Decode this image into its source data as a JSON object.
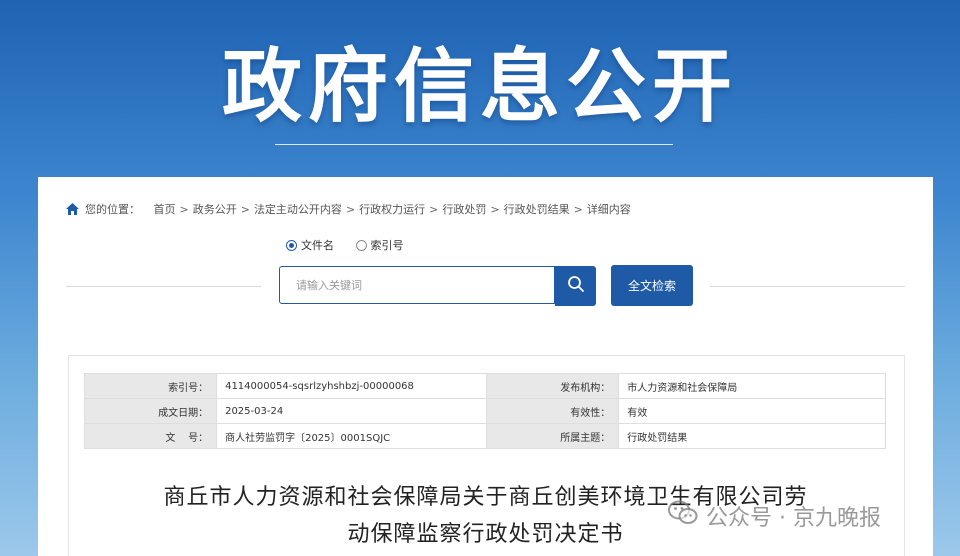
{
  "banner": {
    "title": "政府信息公开"
  },
  "breadcrumb": {
    "label": "您的位置：",
    "items": [
      "首页",
      "政务公开",
      "法定主动公开内容",
      "行政权力运行",
      "行政处罚",
      "行政处罚结果",
      "详细内容"
    ]
  },
  "search": {
    "radio_options": [
      "文件名",
      "索引号"
    ],
    "selected": "文件名",
    "placeholder": "请输入关键词",
    "full_text_button": "全文检索"
  },
  "meta": {
    "index_label": "索引号：",
    "index_value": "4114000054-sqsrlzyhshbzj-00000068",
    "issuer_label": "发布机构：",
    "issuer_value": "市人力资源和社会保障局",
    "date_label": "成文日期：",
    "date_value": "2025-03-24",
    "validity_label": "有效性：",
    "validity_value": "有效",
    "docno_label": "文    号：",
    "docno_value": "商人社劳监罚字〔2025〕0001SQJC",
    "topic_label": "所属主题：",
    "topic_value": "行政处罚结果"
  },
  "document": {
    "title_line1": "商丘市人力资源和社会保障局关于商丘创美环境卫生有限公司劳",
    "title_line2": "动保障监察行政处罚决定书"
  },
  "watermark": {
    "text": "公众号 · 京九晚报"
  },
  "colors": {
    "accent": "#1e5aa6",
    "banner_top": "#1f63b3",
    "banner_bottom": "#9cc8eb"
  }
}
